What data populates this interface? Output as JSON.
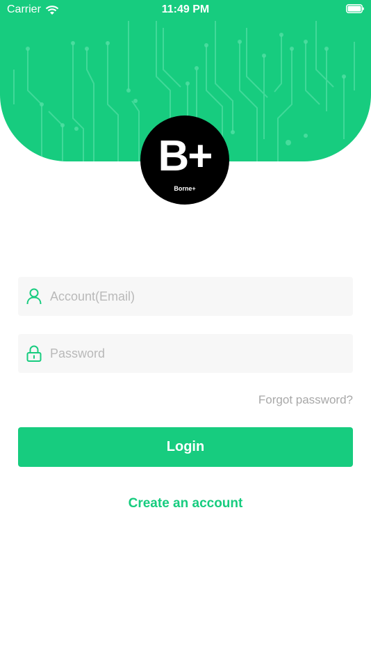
{
  "status_bar": {
    "carrier": "Carrier",
    "time": "11:49 PM"
  },
  "logo": {
    "mark": "B+",
    "subtitle": "Borne+"
  },
  "form": {
    "account_placeholder": "Account(Email)",
    "account_value": "",
    "password_placeholder": "Password",
    "password_value": "",
    "forgot_label": "Forgot password?",
    "login_label": "Login",
    "create_label": "Create an account"
  },
  "colors": {
    "brand_green": "#17cc7f",
    "field_background": "#f7f7f7",
    "placeholder_gray": "#b9b9b9"
  },
  "icons": {
    "account": "user-icon",
    "password": "lock-icon",
    "wifi": "wifi-icon",
    "battery": "battery-icon"
  }
}
